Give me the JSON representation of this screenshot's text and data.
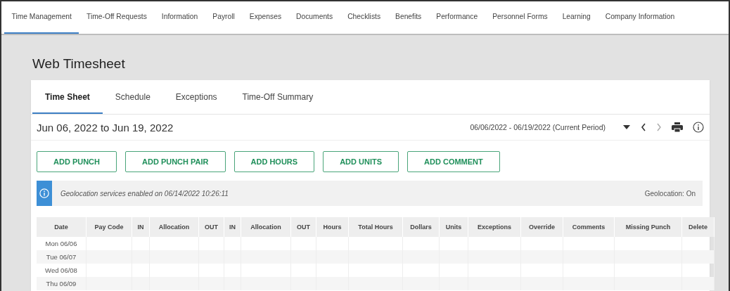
{
  "nav": [
    {
      "label": "Time Management",
      "selected": true
    },
    {
      "label": "Time-Off Requests",
      "selected": false
    },
    {
      "label": "Information",
      "selected": false
    },
    {
      "label": "Payroll",
      "selected": false
    },
    {
      "label": "Expenses",
      "selected": false
    },
    {
      "label": "Documents",
      "selected": false
    },
    {
      "label": "Checklists",
      "selected": false
    },
    {
      "label": "Benefits",
      "selected": false
    },
    {
      "label": "Performance",
      "selected": false
    },
    {
      "label": "Personnel Forms",
      "selected": false
    },
    {
      "label": "Learning",
      "selected": false
    },
    {
      "label": "Company Information",
      "selected": false
    }
  ],
  "page_title": "Web Timesheet",
  "tabs": [
    {
      "label": "Time Sheet",
      "selected": true
    },
    {
      "label": "Schedule",
      "selected": false
    },
    {
      "label": "Exceptions",
      "selected": false
    },
    {
      "label": "Time-Off Summary",
      "selected": false
    }
  ],
  "range_title": "Jun 06, 2022 to Jun 19, 2022",
  "period": "06/06/2022 - 06/19/2022 (Current Period)",
  "buttons": [
    "ADD PUNCH",
    "ADD PUNCH PAIR",
    "ADD HOURS",
    "ADD UNITS",
    "ADD COMMENT"
  ],
  "notice": {
    "message": "Geolocation services enabled on 06/14/2022 10:26:11",
    "status": "Geolocation: On"
  },
  "table": {
    "columns": [
      "Date",
      "Pay Code",
      "IN",
      "Allocation",
      "OUT",
      "IN",
      "Allocation",
      "OUT",
      "Hours",
      "Total Hours",
      "Dollars",
      "Units",
      "Exceptions",
      "Override",
      "Comments",
      "Missing Punch",
      "Delete"
    ],
    "rows": [
      {
        "date": "Mon 06/06"
      },
      {
        "date": "Tue 06/07"
      },
      {
        "date": "Wed 06/08"
      },
      {
        "date": "Thu 06/09"
      }
    ]
  }
}
